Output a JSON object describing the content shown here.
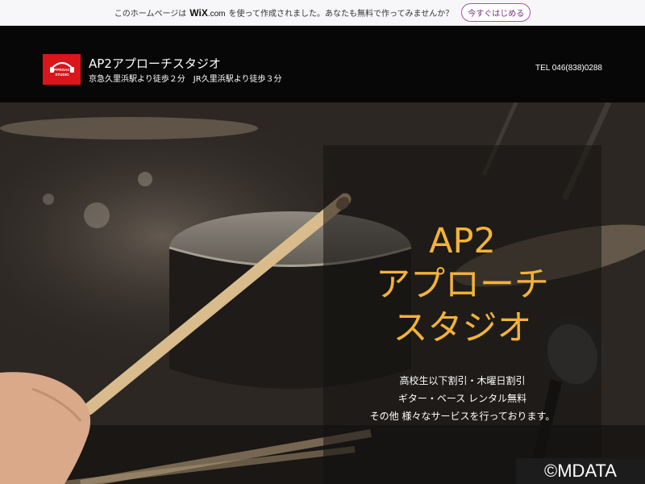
{
  "wix_banner": {
    "text_before": "このホームページは",
    "wix_brand": "WiX",
    "wix_brand_suffix": ".com",
    "text_after": "を使って作成されました。あなたも無料で作ってみませんか？",
    "start_button": "今すぐはじめる"
  },
  "header": {
    "logo_text_top": "APPROACH",
    "logo_text_bottom": "STUDIO",
    "title": "AP2アプローチスタジオ",
    "access": "京急久里浜駅より徒歩２分　JR久里浜駅より徒歩３分",
    "tel": "TEL 046(838)0288"
  },
  "hero": {
    "title_lines": [
      "AP2",
      "アプローチ",
      "スタジオ"
    ],
    "lines": [
      "高校生以下割引・木曜日割引",
      "ギター・ベース レンタル無料",
      "その他 様々なサービスを行っております。"
    ]
  },
  "watermark": "©MDATA",
  "colors": {
    "accent": "#f3b337",
    "logo_red": "#d8161b",
    "header_bg": "#070707",
    "wix_button_border": "#b14bb3"
  },
  "icons": {
    "logo": "headphones-logo-icon"
  }
}
